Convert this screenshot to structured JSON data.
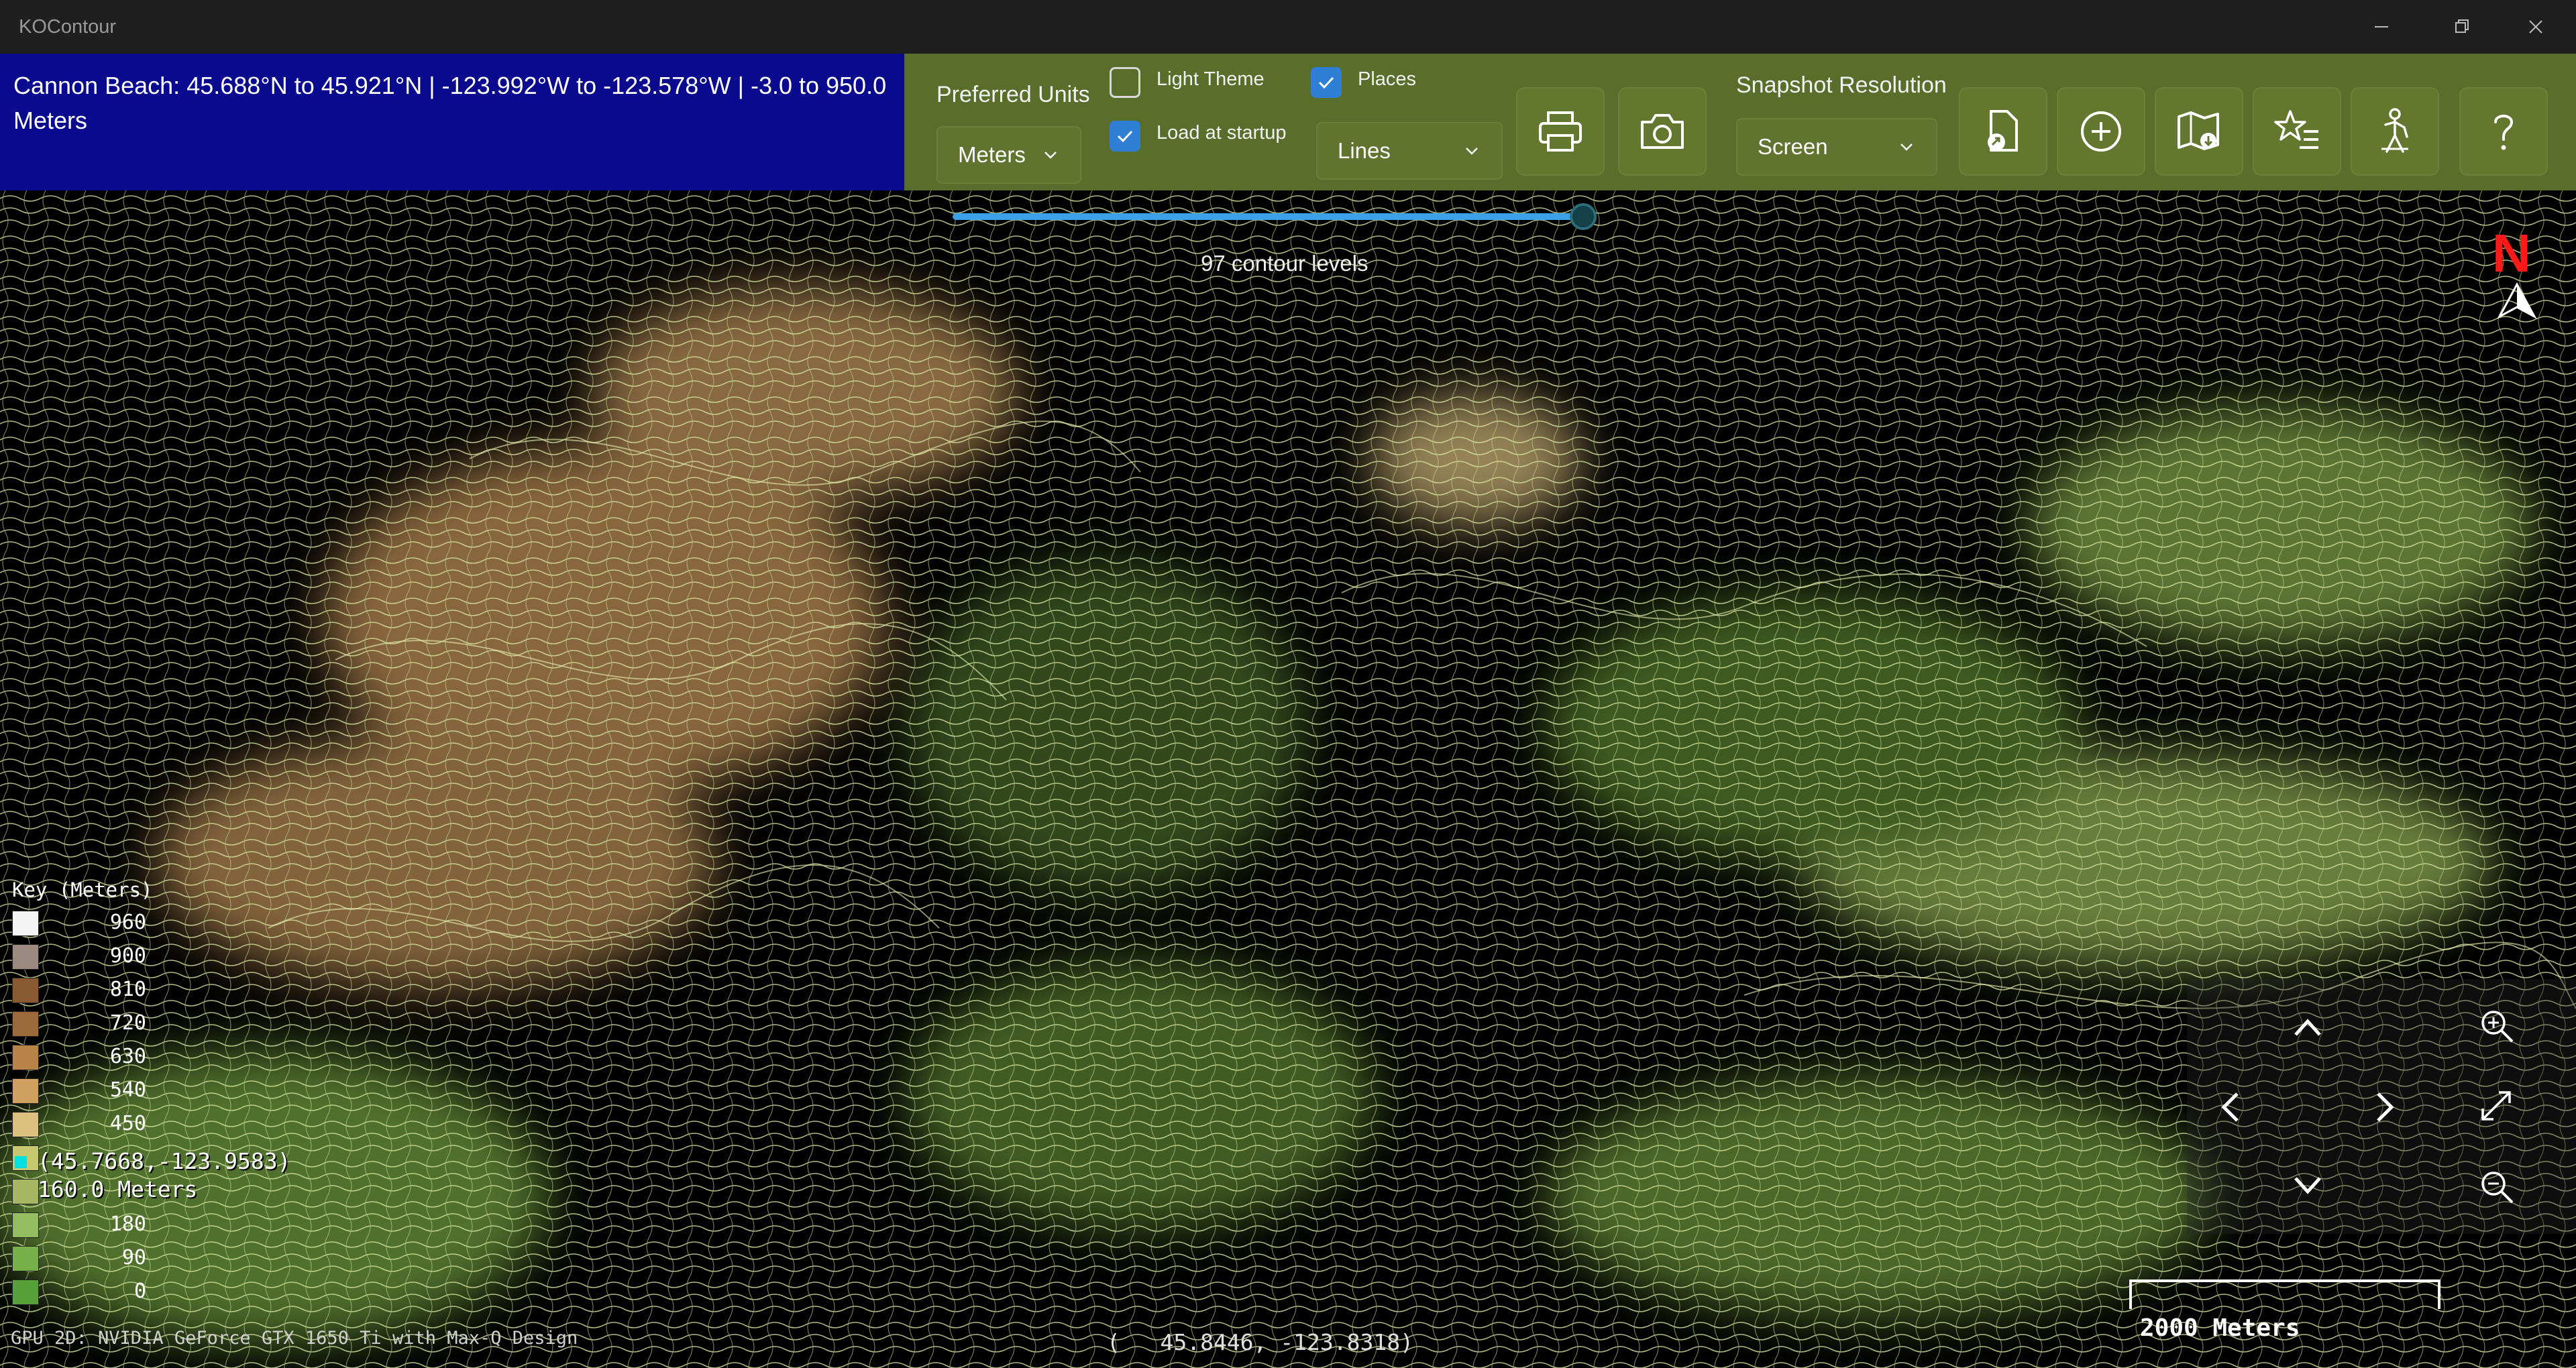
{
  "window": {
    "title": "KOContour"
  },
  "header": {
    "info_text": "Cannon Beach:  45.688°N to 45.921°N | -123.992°W to -123.578°W | -3.0 to 950.0 Meters"
  },
  "toolbar": {
    "preferred_units_label": "Preferred Units",
    "units_value": "Meters",
    "light_theme_label": "Light Theme",
    "light_theme_checked": false,
    "load_startup_label": "Load at startup",
    "load_startup_checked": true,
    "places_label": "Places",
    "places_checked": true,
    "render_mode_value": "Lines",
    "snapshot_label": "Snapshot Resolution",
    "snapshot_value": "Screen",
    "buttons": [
      "print-icon",
      "camera-icon",
      "export-icon",
      "add-icon",
      "map-download-icon",
      "favorites-icon",
      "hiker-icon",
      "help-icon"
    ]
  },
  "map": {
    "contour_levels_text": "97 contour levels",
    "contour_slider_value": 0.97,
    "north_label": "N",
    "legend": {
      "title": "Key (Meters)",
      "entries": [
        {
          "value": "960",
          "color": "#f4f4f4"
        },
        {
          "value": "900",
          "color": "#9c8a80"
        },
        {
          "value": "810",
          "color": "#8a5a32"
        },
        {
          "value": "720",
          "color": "#9c6a3a"
        },
        {
          "value": "630",
          "color": "#b88448"
        },
        {
          "value": "540",
          "color": "#d0a060"
        },
        {
          "value": "450",
          "color": "#dcc080"
        },
        {
          "value": "",
          "color": "#c8c870"
        },
        {
          "value": "",
          "color": "#a8b860"
        },
        {
          "value": "180",
          "color": "#94bc60"
        },
        {
          "value": "90",
          "color": "#78b04a"
        },
        {
          "value": "0",
          "color": "#58a03a"
        }
      ]
    },
    "cursor_coord": "(45.7668,-123.9583)",
    "cursor_elevation": "160.0 Meters",
    "gpu_text": "GPU 2D: NVIDIA GeForce GTX 1650 Ti with Max-Q Design",
    "center_coord": "(   45.8446, -123.8318)",
    "scale_label": "2000 Meters"
  },
  "colors": {
    "info_bg": "#0a0a8f",
    "toolbar_bg": "#5a6e2c",
    "contour_line": "#d8e6a0",
    "accent_blue": "#2f7fd6"
  }
}
